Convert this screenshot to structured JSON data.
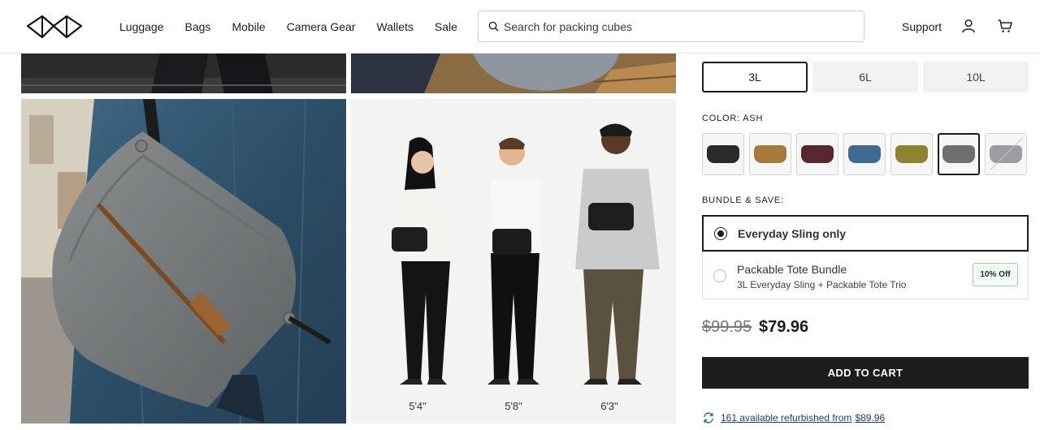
{
  "header": {
    "nav": [
      "Luggage",
      "Bags",
      "Mobile",
      "Camera Gear",
      "Wallets",
      "Sale"
    ],
    "search_placeholder": "Search for packing cubes",
    "support_label": "Support"
  },
  "gallery": {
    "height_labels": [
      "5'4\"",
      "5'8\"",
      "6'3\""
    ]
  },
  "product": {
    "sizes": [
      {
        "label": "3L",
        "selected": true
      },
      {
        "label": "6L",
        "selected": false
      },
      {
        "label": "10L",
        "selected": false
      }
    ],
    "color_label": "COLOR: ASH",
    "colors": [
      {
        "name": "black",
        "hex": "#2a2a2a"
      },
      {
        "name": "coyote",
        "hex": "#a57a3a"
      },
      {
        "name": "eclipse",
        "hex": "#5a2630"
      },
      {
        "name": "midnight",
        "hex": "#3f6a92"
      },
      {
        "name": "olive",
        "hex": "#8d8430"
      },
      {
        "name": "ash",
        "hex": "#6e7070",
        "selected": true
      },
      {
        "name": "sage",
        "hex": "#9a9da3",
        "sold_out": true
      }
    ],
    "bundle_label": "BUNDLE & SAVE:",
    "bundles": [
      {
        "title": "Everyday Sling only",
        "selected": true
      },
      {
        "title": "Packable Tote Bundle",
        "subtitle": "3L Everyday Sling + Packable Tote Trio",
        "badge": "10% Off"
      }
    ],
    "price_original": "$99.95",
    "price_sale": "$79.96",
    "add_to_cart_label": "ADD TO CART",
    "refurb_text": "161 available refurbished from",
    "refurb_price": "$89.96"
  }
}
